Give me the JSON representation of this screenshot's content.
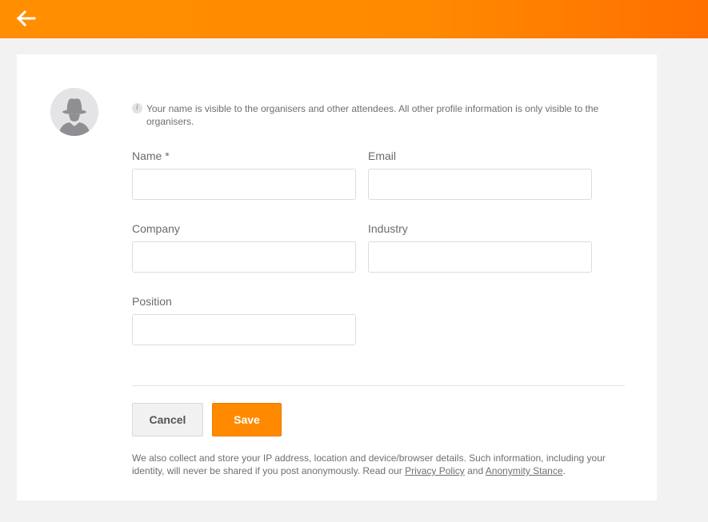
{
  "header": {
    "back_icon": "arrow-left-icon",
    "background_start": "#ff8f00",
    "background_end": "#ff6f00"
  },
  "profile": {
    "avatar_icon": "anonymous-user-icon",
    "notice_icon": "info-icon",
    "notice_text": "Your name is visible to the organisers and other attendees. All other profile information is only visible to the organisers."
  },
  "form": {
    "name": {
      "label": "Name *",
      "value": "",
      "placeholder": ""
    },
    "email": {
      "label": "Email",
      "value": "",
      "placeholder": ""
    },
    "company": {
      "label": "Company",
      "value": "",
      "placeholder": ""
    },
    "industry": {
      "label": "Industry",
      "value": "",
      "placeholder": ""
    },
    "position": {
      "label": "Position",
      "value": "",
      "placeholder": ""
    }
  },
  "actions": {
    "cancel_label": "Cancel",
    "save_label": "Save",
    "save_color": "#ff8a00"
  },
  "footer": {
    "text_before": "We also collect and store your IP address, location and device/browser details. Such information, including your identity, will never be shared if you post anonymously. Read our ",
    "privacy_link": "Privacy Policy",
    "text_and": " and ",
    "anonymity_link": "Anonymity Stance",
    "text_end": "."
  }
}
